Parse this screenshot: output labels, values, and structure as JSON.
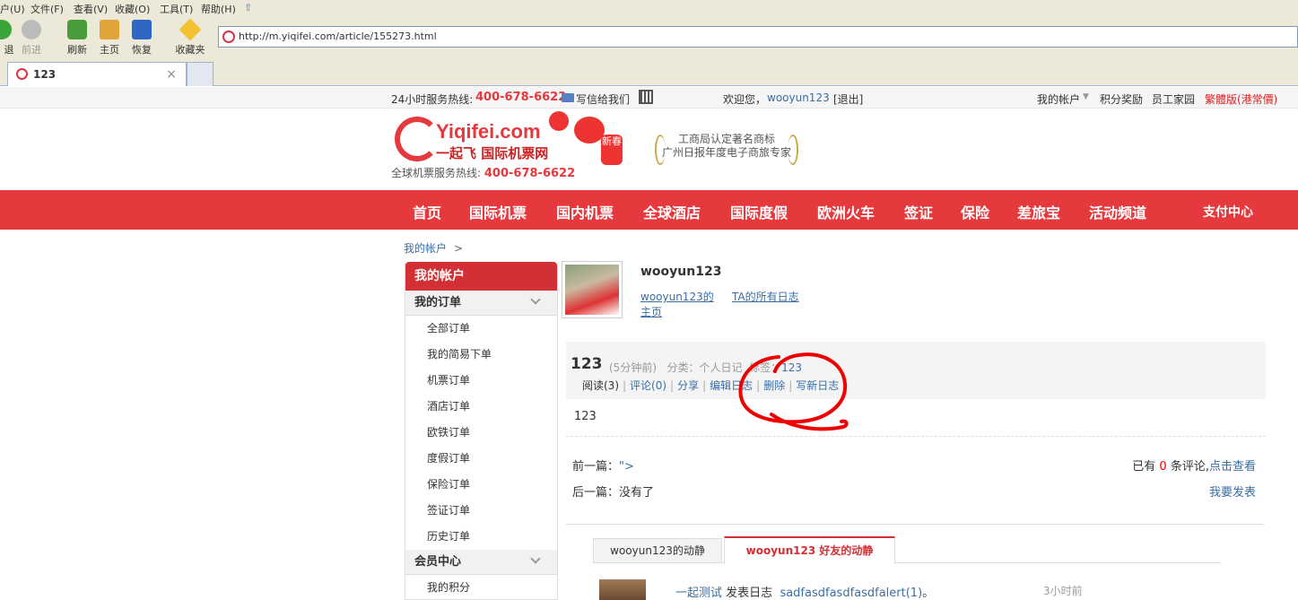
{
  "browser": {
    "menu": [
      "户(U)",
      "文件(F)",
      "查看(V)",
      "收藏(O)",
      "工具(T)",
      "帮助(H)"
    ],
    "toolbar": {
      "back": "退",
      "forward": "前进",
      "refresh": "刷新",
      "home": "主页",
      "restore": "恢复",
      "favorites": "收藏夹"
    },
    "address": "http://m.yiqifei.com/article/155273.html",
    "tab_title": "123",
    "tab_close": "×"
  },
  "topbar": {
    "hotline_label": "24小时服务热线:",
    "hotline": "400-678-6622",
    "mail": "写信给我们",
    "welcome": "欢迎您，",
    "user": "wooyun123",
    "logout": "[退出]",
    "links": [
      "我的帐户",
      "积分奖励",
      "员工家园",
      "繁體版(港常價)"
    ]
  },
  "logo": {
    "en": "Yiqifei.com",
    "cn": "一起飞 国际机票网",
    "hotline_label": "全球机票服务热线:",
    "hotline": "400-678-6622",
    "badge": "新春",
    "award": [
      "工商局认定著名商标",
      "广州日报年度电子商旅专家"
    ]
  },
  "nav": {
    "items": [
      "首页",
      "国际机票",
      "国内机票",
      "全球酒店",
      "国际度假",
      "欧洲火车",
      "签证",
      "保险",
      "差旅宝",
      "活动频道"
    ],
    "pay": "支付中心"
  },
  "breadcrumb": {
    "home": "我的帐户",
    "sep": ">"
  },
  "sidebar": {
    "title": "我的帐户",
    "sections": [
      {
        "label": "我的订单",
        "items": [
          "全部订单",
          "我的简易下单",
          "机票订单",
          "酒店订单",
          "欧铁订单",
          "度假订单",
          "保险订单",
          "签证订单",
          "历史订单"
        ]
      },
      {
        "label": "会员中心",
        "items": [
          "我的积分"
        ]
      }
    ]
  },
  "profile": {
    "name": "wooyun123",
    "home_link": "wooyun123的主页",
    "all_logs": "TA的所有日志"
  },
  "post": {
    "title": "123",
    "time": "(5分钟前)",
    "category_label": "分类：",
    "category": "个人日记",
    "tag_label": "标签：",
    "tag": "123",
    "actions": [
      "阅读(3)",
      "评论(0)",
      "分享",
      "编辑日志",
      "删除",
      "写新日志"
    ],
    "body": "123"
  },
  "pager": {
    "prev_label": "前一篇：",
    "prev": "\">",
    "next_label": "后一篇：",
    "next": "没有了",
    "comments_pre": "已有",
    "comments_count": "0",
    "comments_post": "条评论,",
    "view": "点击查看",
    "post_comment": "我要发表"
  },
  "feed": {
    "tabs": [
      "wooyun123的动静",
      "wooyun123 好友的动静"
    ],
    "item": {
      "user": "一起测试",
      "action": "发表日志",
      "title": "sadfasdfasdfasdfalert(1)",
      "end": "。",
      "time": "3小时前"
    }
  },
  "colors": {
    "brand_red": "#e6393d",
    "link": "#3a6ea5"
  }
}
